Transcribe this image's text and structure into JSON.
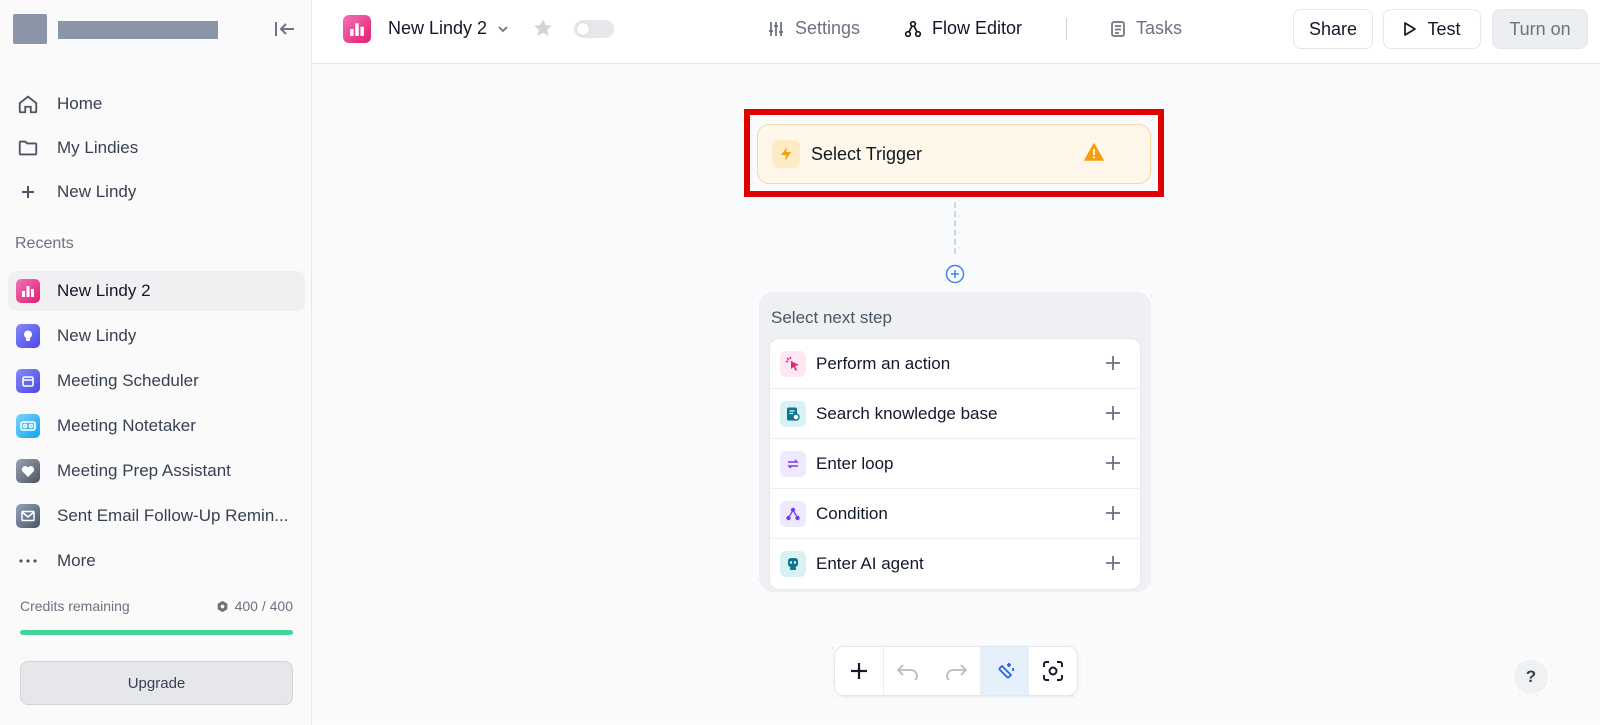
{
  "sidebar": {
    "nav": [
      {
        "label": "Home",
        "icon": "home-icon"
      },
      {
        "label": "My Lindies",
        "icon": "folder-icon"
      },
      {
        "label": "New Lindy",
        "icon": "plus-icon"
      }
    ],
    "recents_label": "Recents",
    "recents": [
      {
        "label": "New Lindy 2",
        "icon": "bar-chart-icon",
        "color": "#ec4899",
        "active": true
      },
      {
        "label": "New Lindy",
        "icon": "lightbulb-icon",
        "color": "#6366f1"
      },
      {
        "label": "Meeting Scheduler",
        "icon": "calendar-icon",
        "color": "#6366f1"
      },
      {
        "label": "Meeting Notetaker",
        "icon": "voicemail-icon",
        "color": "#38bdf8"
      },
      {
        "label": "Meeting Prep Assistant",
        "icon": "heart-icon",
        "color": "#6b7280"
      },
      {
        "label": "Sent Email Follow-Up Remin...",
        "icon": "mail-icon",
        "color": "#64748b"
      }
    ],
    "more_label": "More",
    "credits_label": "Credits remaining",
    "credits_value": "400 / 400",
    "credits_fraction": 1.0,
    "upgrade_label": "Upgrade"
  },
  "header": {
    "title": "New Lindy 2",
    "settings_label": "Settings",
    "flow_editor_label": "Flow Editor",
    "tasks_label": "Tasks",
    "share_label": "Share",
    "test_label": "Test",
    "turn_on_label": "Turn on"
  },
  "canvas": {
    "trigger_label": "Select Trigger",
    "next_step_title": "Select next step",
    "steps": [
      {
        "label": "Perform an action",
        "icon": "sparkle-cursor-icon"
      },
      {
        "label": "Search knowledge base",
        "icon": "knowledge-base-icon"
      },
      {
        "label": "Enter loop",
        "icon": "loop-icon"
      },
      {
        "label": "Condition",
        "icon": "condition-icon"
      },
      {
        "label": "Enter AI agent",
        "icon": "robot-icon"
      }
    ],
    "help_label": "?"
  },
  "colors": {
    "accent": "#2563eb",
    "highlight": "#e10000",
    "trigger_bg": "#fff7ea",
    "progress": "#46d39a"
  }
}
